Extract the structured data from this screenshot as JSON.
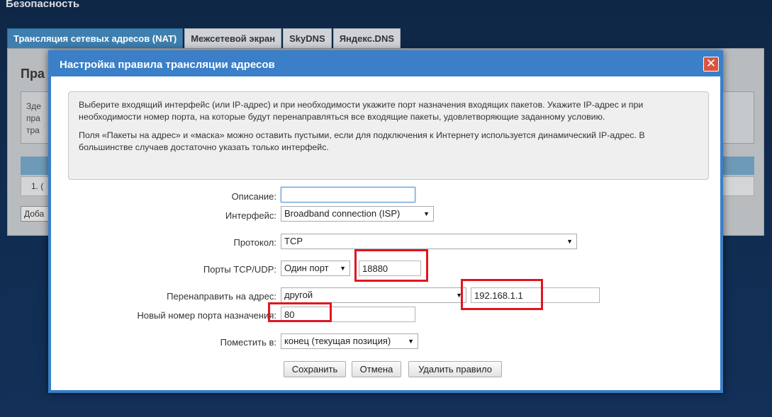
{
  "page": {
    "section_title": "Безопасность"
  },
  "tabs": [
    {
      "label": "Трансляция сетевых адресов (NAT)",
      "active": true
    },
    {
      "label": "Межсетевой экран"
    },
    {
      "label": "SkyDNS"
    },
    {
      "label": "Яндекс.DNS"
    }
  ],
  "background": {
    "heading": "Пра",
    "lines": [
      "Зде",
      "пра",
      "тра"
    ],
    "row_number": "1. (",
    "add_button": "Доба"
  },
  "dialog": {
    "title": "Настройка правила трансляции адресов",
    "close_label": "✕",
    "info": {
      "paragraph1": "Выберите входящий интерфейс (или IP-адрес) и при необходимости укажите порт назначения входящих пакетов. Укажите IP-адрес и при необходимости номер порта, на которые будут перенаправляться все входящие пакеты, удовлетворяющие заданному условию.",
      "paragraph2": "Поля «Пакеты на адрес» и «маска» можно оставить пустыми, если для подключения к Интернету используется динамический IP-адрес. В большинстве случаев достаточно указать только интерфейс."
    },
    "form": {
      "description_label": "Описание:",
      "description_value": "",
      "interface_label": "Интерфейс:",
      "interface_value": "Broadband connection (ISP)",
      "protocol_label": "Протокол:",
      "protocol_value": "TCP",
      "ports_label": "Порты TCP/UDP:",
      "ports_mode_value": "Один порт",
      "port_value": "18880",
      "redirect_label": "Перенаправить на адрес:",
      "redirect_mode_value": "другой",
      "redirect_ip_value": "192.168.1.1",
      "new_port_label": "Новый номер порта назначения:",
      "new_port_value": "80",
      "place_label": "Поместить в:",
      "place_value": "конец (текущая позиция)"
    },
    "buttons": {
      "save": "Сохранить",
      "cancel": "Отмена",
      "delete": "Удалить правило"
    }
  },
  "colors": {
    "highlight": "#e0161f",
    "dialog_accent": "#3a7fc8",
    "active_tab": "#3e7fb0"
  }
}
